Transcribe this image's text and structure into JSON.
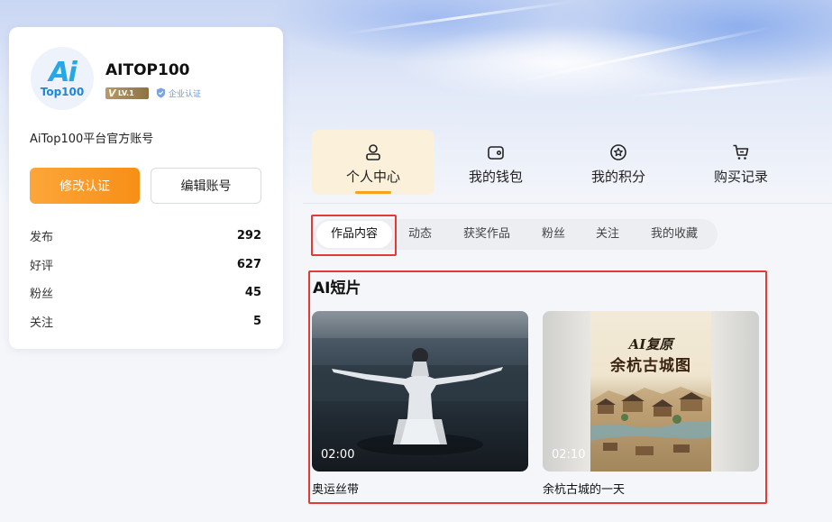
{
  "profile": {
    "avatar_logo_text": "Ai",
    "avatar_logo_subtext": "Top100",
    "username": "AITOP100",
    "level_badge": "LV.1",
    "enterprise_badge": "企业认证",
    "bio": "AiTop100平台官方账号",
    "buttons": {
      "edit_certification": "修改认证",
      "edit_account": "编辑账号"
    },
    "stats": [
      {
        "label": "发布",
        "value": "292"
      },
      {
        "label": "好评",
        "value": "627"
      },
      {
        "label": "粉丝",
        "value": "45"
      },
      {
        "label": "关注",
        "value": "5"
      }
    ]
  },
  "nav": {
    "items": [
      {
        "label": "个人中心",
        "icon": "user-icon",
        "active": true
      },
      {
        "label": "我的钱包",
        "icon": "wallet-icon",
        "active": false
      },
      {
        "label": "我的积分",
        "icon": "star-badge-icon",
        "active": false
      },
      {
        "label": "购买记录",
        "icon": "cart-icon",
        "active": false
      }
    ]
  },
  "subtabs": [
    {
      "label": "作品内容",
      "active": true
    },
    {
      "label": "动态",
      "active": false
    },
    {
      "label": "获奖作品",
      "active": false
    },
    {
      "label": "粉丝",
      "active": false
    },
    {
      "label": "关注",
      "active": false
    },
    {
      "label": "我的收藏",
      "active": false
    }
  ],
  "section": {
    "title": "AI短片",
    "videos": [
      {
        "title": "奥运丝带",
        "duration": "02:00"
      },
      {
        "title": "余杭古城的一天",
        "duration": "02:10",
        "poster_line1": "AI复原",
        "poster_line2": "余杭古城图"
      }
    ]
  },
  "colors": {
    "accent_orange": "#f7a21d",
    "highlight_red": "#e53935",
    "active_tab_bg": "#fbf0d9"
  }
}
